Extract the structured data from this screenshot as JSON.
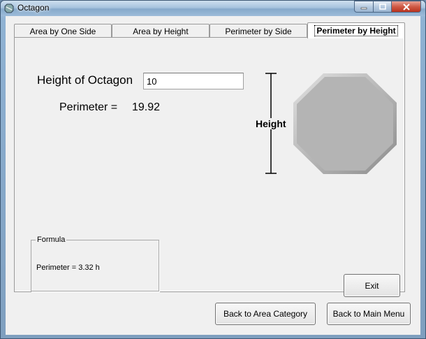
{
  "window": {
    "title": "Octagon",
    "icon": "octagon-app-icon",
    "controls": {
      "minimize": "minimize-icon",
      "maximize": "maximize-icon",
      "close": "close-icon"
    }
  },
  "tabs": [
    {
      "label": "Area by One Side",
      "active": false
    },
    {
      "label": "Area by Height",
      "active": false
    },
    {
      "label": "Perimeter by Side",
      "active": false
    },
    {
      "label": "Perimeter by Height",
      "active": true
    }
  ],
  "panel": {
    "height_label": "Height of Octagon",
    "height_value": "10",
    "perimeter_label": "Perimeter =",
    "perimeter_value": "19.92",
    "diagram_label": "Height",
    "formula": {
      "legend": "Formula",
      "text": "Perimeter = 3.32 h"
    },
    "exit_label": "Exit"
  },
  "footer": {
    "back_area_label": "Back to Area Category",
    "back_main_label": "Back to Main Menu"
  },
  "colors": {
    "octagon_fill": "#b4b4b4",
    "client_bg": "#f0f0f0",
    "close_button": "#cf5a45"
  }
}
